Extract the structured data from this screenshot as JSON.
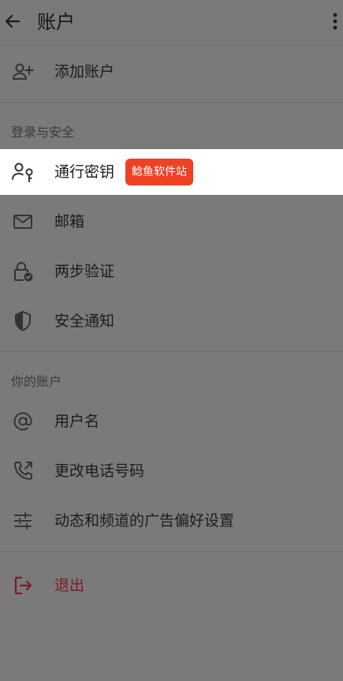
{
  "header": {
    "title": "账户",
    "back_icon": "arrow-left-icon",
    "more_icon": "more-vertical-icon"
  },
  "items": {
    "add_account": {
      "label": "添加账户",
      "icon": "person-add-icon"
    },
    "passkey": {
      "label": "通行密钥",
      "icon": "person-key-icon"
    },
    "email": {
      "label": "邮箱",
      "icon": "mail-icon"
    },
    "two_step": {
      "label": "两步验证",
      "icon": "lock-check-icon"
    },
    "security_notice": {
      "label": "安全通知",
      "icon": "shield-icon"
    },
    "username": {
      "label": "用户名",
      "icon": "at-icon"
    },
    "change_phone": {
      "label": "更改电话号码",
      "icon": "phone-forward-icon"
    },
    "ad_prefs": {
      "label": "动态和频道的广告偏好设置",
      "icon": "sliders-icon"
    },
    "logout": {
      "label": "退出",
      "icon": "logout-icon"
    }
  },
  "sections": {
    "login_security": "登录与安全",
    "your_account": "你的账户"
  },
  "badge": {
    "text": "鲶鱼软件站",
    "color": "#ee4126"
  },
  "colors": {
    "overlay_background": "#7a7a7a",
    "highlight_row": "#ffffff",
    "logout_text": "#7c1a24"
  }
}
